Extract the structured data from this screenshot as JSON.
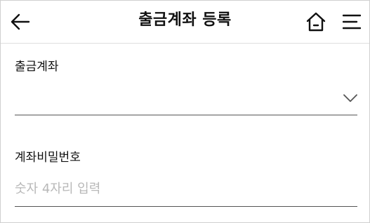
{
  "header": {
    "title": "출금계좌 등록",
    "back_icon": "back-arrow-icon",
    "home_icon": "home-icon",
    "menu_icon": "hamburger-menu-icon"
  },
  "form": {
    "account_label": "출금계좌",
    "account_value": "",
    "password_label": "계좌비밀번호",
    "password_placeholder": "숫자 4자리 입력",
    "password_value": ""
  },
  "colors": {
    "text": "#111111",
    "placeholder": "#b8b8b8",
    "underline": "#555555",
    "divider": "#dedede"
  }
}
